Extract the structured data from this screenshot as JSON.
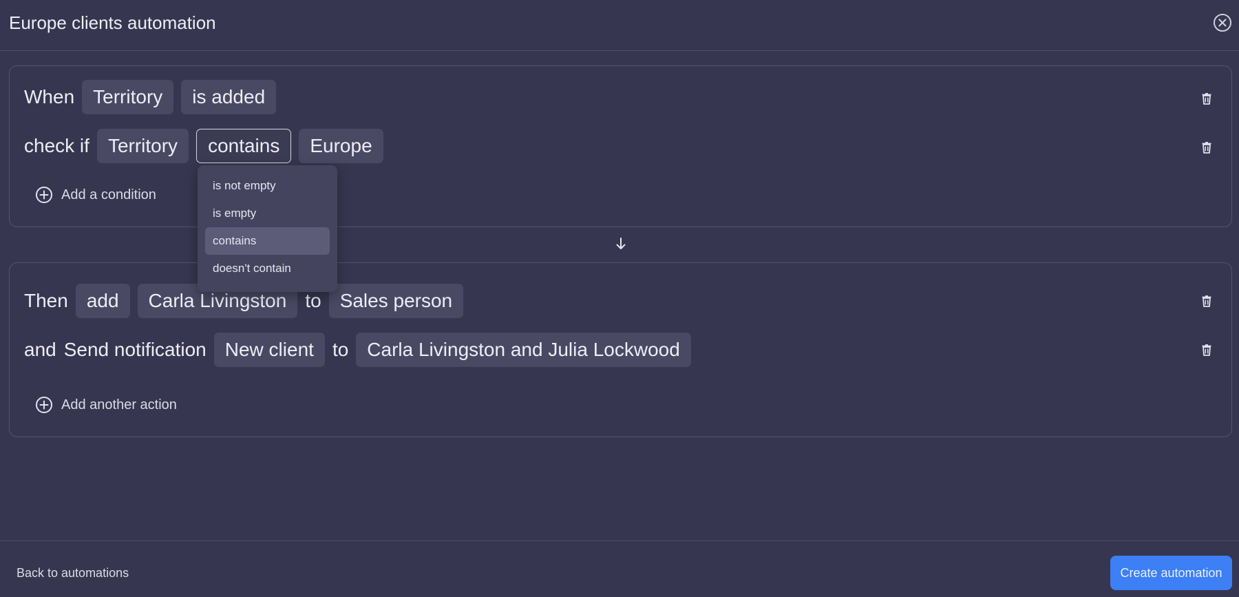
{
  "window": {
    "title": "Europe clients automation",
    "close_icon": "close-circle-icon"
  },
  "trigger": {
    "when_word": "When",
    "field": "Territory",
    "event": "is added"
  },
  "condition": {
    "check_word": "check if",
    "field": "Territory",
    "operator": "contains",
    "value": "Europe",
    "add_condition_label": "Add a condition"
  },
  "operator_dropdown": {
    "options": [
      "is not empty",
      "is empty",
      "contains",
      "doesn't contain"
    ],
    "selected": "contains"
  },
  "actions": {
    "then_word": "Then",
    "action1": {
      "verb": "add",
      "person": "Carla Livingston",
      "to_word": "to",
      "target": "Sales person"
    },
    "and_word": "and",
    "action2": {
      "verb": "Send notification",
      "template": "New client",
      "to_word": "to",
      "recipients": "Carla Livingston and Julia Lockwood"
    },
    "add_action_label": "Add another action"
  },
  "footer": {
    "back_label": "Back to automations",
    "create_label": "Create automation"
  },
  "colors": {
    "background": "#373650",
    "chip": "#4a4964",
    "accent": "#3d7ff5"
  }
}
